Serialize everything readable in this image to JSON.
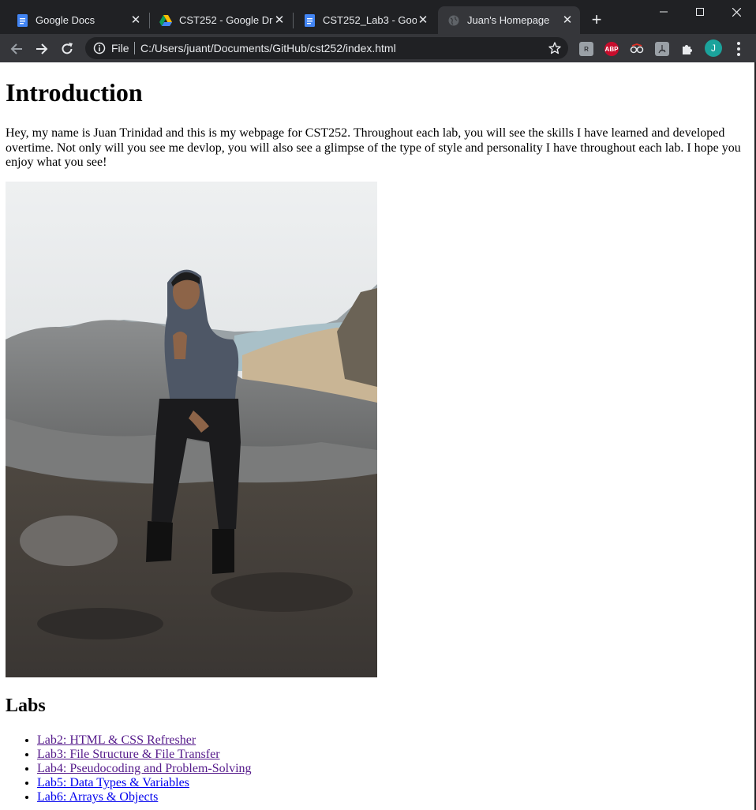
{
  "browser": {
    "tabs": [
      {
        "title": "Google Docs",
        "icon": "google-docs-icon",
        "active": false
      },
      {
        "title": "CST252 - Google Drive",
        "icon": "google-drive-icon",
        "active": false
      },
      {
        "title": "CST252_Lab3 - Google Docs",
        "icon": "google-docs-icon",
        "active": false
      },
      {
        "title": "Juan's Homepage",
        "icon": "globe-icon",
        "active": true
      }
    ],
    "address_scheme": "File",
    "address_url": "C:/Users/juant/Documents/GitHub/cst252/index.html",
    "profile_initial": "J",
    "extensions": [
      "extension-r-icon",
      "adblock-plus-icon",
      "extension-spy-icon",
      "acrobat-icon",
      "puzzle-icon"
    ],
    "adblock_label": "ABP",
    "colors": {
      "titlebar": "#202124",
      "toolbar": "#35363a",
      "profile": "#1ba39c"
    }
  },
  "page": {
    "heading": "Introduction",
    "intro": "Hey, my name is Juan Trinidad and this is my webpage for CST252. Throughout each lab, you will see the skills I have learned and developed overtime. Not only will you see me devlop, you will also see a glimpse of the type of style and personality I have throughout each lab. I hope you enjoy what you see!",
    "labs_heading": "Labs",
    "labs": [
      {
        "label": "Lab2: HTML & CSS Refresher",
        "visited": true
      },
      {
        "label": "Lab3: File Structure & File Transfer",
        "visited": true
      },
      {
        "label": "Lab4: Pseudocoding and Problem-Solving",
        "visited": true
      },
      {
        "label": "Lab5: Data Types & Variables",
        "visited": false
      },
      {
        "label": "Lab6: Arrays & Objects",
        "visited": false
      }
    ],
    "colors": {
      "link": "#0000ee",
      "visited": "#551a8b"
    }
  }
}
